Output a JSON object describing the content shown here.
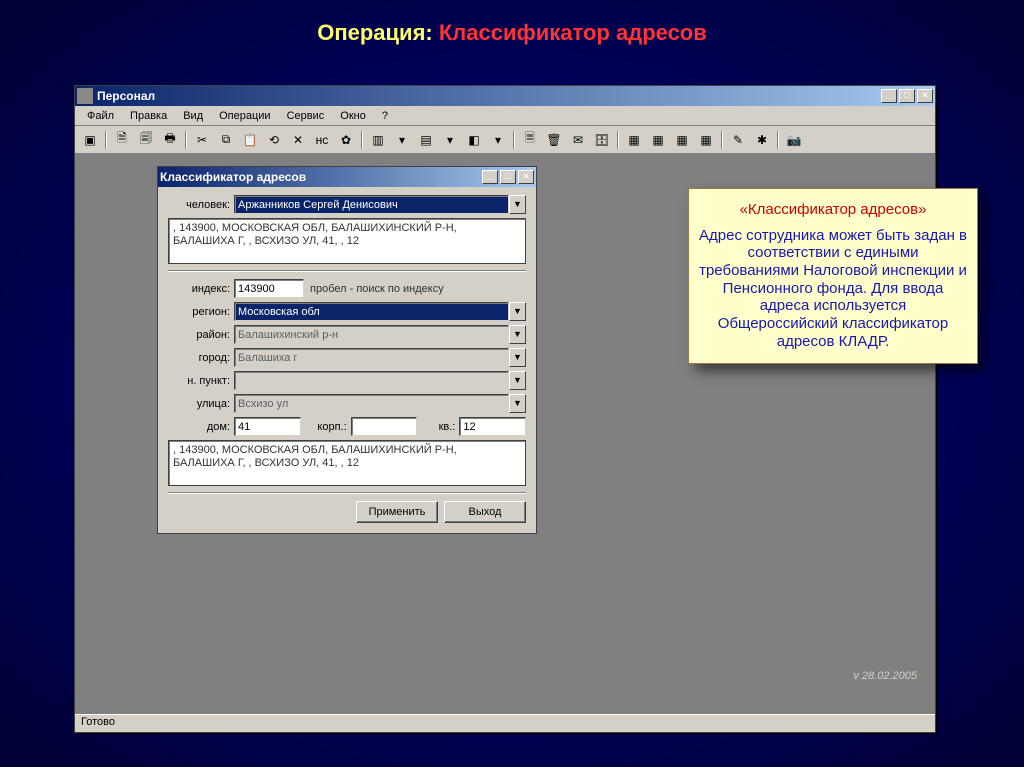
{
  "slide": {
    "prefix": "Операция: ",
    "title": "Классификатор адресов"
  },
  "app": {
    "title": "Персонал",
    "menu": [
      "Файл",
      "Правка",
      "Вид",
      "Операции",
      "Сервис",
      "Окно",
      "?"
    ],
    "status_left": "Готово",
    "version": "v 28.02.2005"
  },
  "dialog": {
    "title": "Классификатор адресов",
    "labels": {
      "person": "человек:",
      "index": "индекс:",
      "region": "регион:",
      "district": "район:",
      "city": "город:",
      "locality": "н. пункт:",
      "street": "улица:",
      "house": "дом:",
      "block": "корп.:",
      "flat": "кв.:"
    },
    "person": "Аржанников Сергей Денисович",
    "address_preview": ", 143900, МОСКОВСКАЯ ОБЛ, БАЛАШИХИНСКИЙ Р-Н, БАЛАШИХА Г, , ВСХИЗО УЛ, 41, , 12",
    "index": "143900",
    "index_hint": "пробел - поиск по индексу",
    "region": "Московская обл",
    "district": "Балашихинский р-н",
    "city": "Балашиха г",
    "locality": "",
    "street": "Всхизо ул",
    "house": "41",
    "block": "",
    "flat": "12",
    "address_result": ", 143900, МОСКОВСКАЯ ОБЛ, БАЛАШИХИНСКИЙ Р-Н, БАЛАШИХА Г, , ВСХИЗО УЛ, 41, , 12",
    "buttons": {
      "apply": "Применить",
      "exit": "Выход"
    }
  },
  "callout": {
    "header": "«Классификатор адресов»",
    "body": "Адрес сотрудника может быть задан в соответствии с едиными требованиями Налоговой инспекции и Пенсионного фонда. Для ввода адреса используется Общероссийский классификатор адресов КЛАДР."
  }
}
